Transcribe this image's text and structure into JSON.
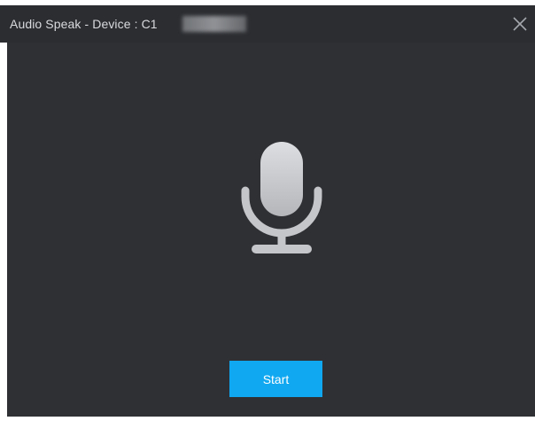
{
  "window": {
    "title": "Audio Speak - Device : C1",
    "close_icon": "close-icon"
  },
  "main": {
    "icon": "microphone-icon",
    "start_label": "Start"
  },
  "colors": {
    "titlebar_bg": "#2b2d31",
    "body_bg": "#2e3034",
    "accent": "#10a8f0",
    "icon": "#c4c6ca"
  }
}
